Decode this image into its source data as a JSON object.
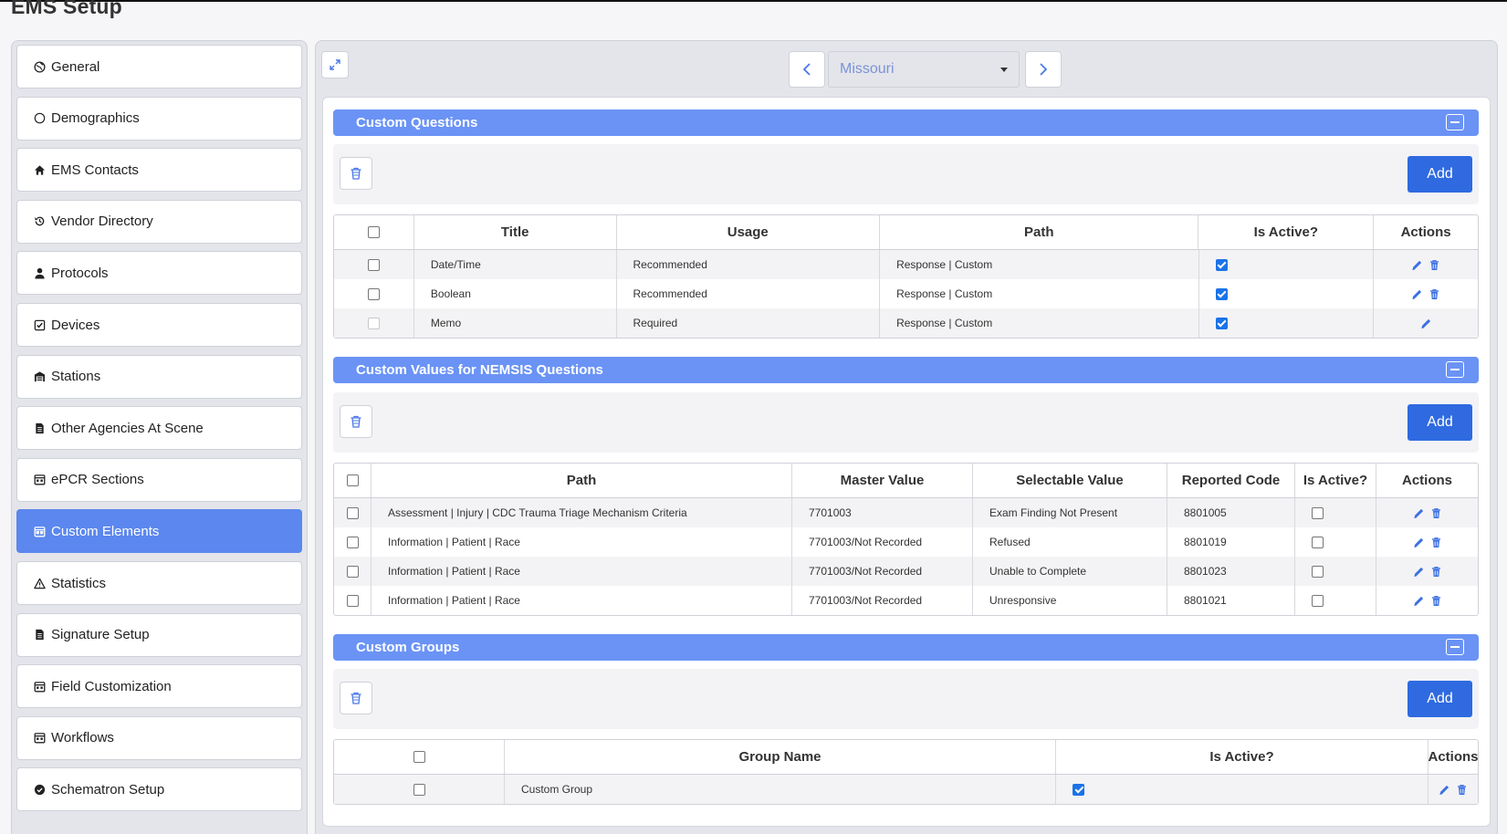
{
  "page": {
    "title": "EMS Setup"
  },
  "sidebar": {
    "items": [
      {
        "label": "General",
        "icon": "globe-icon"
      },
      {
        "label": "Demographics",
        "icon": "circle-icon"
      },
      {
        "label": "EMS Contacts",
        "icon": "home-icon"
      },
      {
        "label": "Vendor Directory",
        "icon": "history-icon"
      },
      {
        "label": "Protocols",
        "icon": "user-icon"
      },
      {
        "label": "Devices",
        "icon": "check-square-icon"
      },
      {
        "label": "Stations",
        "icon": "warehouse-icon"
      },
      {
        "label": "Other Agencies At Scene",
        "icon": "document-icon"
      },
      {
        "label": "ePCR Sections",
        "icon": "calendar-icon"
      },
      {
        "label": "Custom Elements",
        "icon": "calendar-icon",
        "active": true
      },
      {
        "label": "Statistics",
        "icon": "warning-icon"
      },
      {
        "label": "Signature Setup",
        "icon": "document-icon"
      },
      {
        "label": "Field Customization",
        "icon": "calendar-icon"
      },
      {
        "label": "Workflows",
        "icon": "calendar-icon"
      },
      {
        "label": "Schematron Setup",
        "icon": "badge-check-icon"
      }
    ]
  },
  "selector": {
    "value": "Missouri"
  },
  "colors": {
    "accent": "#6a93f5",
    "button": "#2f6ae0",
    "active_nav": "#5b87ee",
    "checked": "#1a73e8"
  },
  "sections": {
    "custom_questions": {
      "title": "Custom Questions",
      "add_label": "Add",
      "columns": [
        "Title",
        "Usage",
        "Path",
        "Is Active?",
        "Actions"
      ],
      "rows": [
        {
          "title": "Date/Time",
          "usage": "Recommended",
          "path": "Response | Custom",
          "active": true,
          "deletable": true
        },
        {
          "title": "Boolean",
          "usage": "Recommended",
          "path": "Response | Custom",
          "active": true,
          "deletable": true
        },
        {
          "title": "Memo",
          "usage": "Required",
          "path": "Response | Custom",
          "active": true,
          "deletable": false
        }
      ]
    },
    "custom_values": {
      "title": "Custom Values for NEMSIS Questions",
      "add_label": "Add",
      "columns": [
        "Path",
        "Master Value",
        "Selectable Value",
        "Reported Code",
        "Is Active?",
        "Actions"
      ],
      "rows": [
        {
          "path": "Assessment | Injury | CDC Trauma Triage Mechanism Criteria",
          "master": "7701003",
          "selectable": "Exam Finding Not Present",
          "code": "8801005",
          "active": false
        },
        {
          "path": "Information | Patient | Race",
          "master": "7701003/Not Recorded",
          "selectable": "Refused",
          "code": "8801019",
          "active": false
        },
        {
          "path": "Information | Patient | Race",
          "master": "7701003/Not Recorded",
          "selectable": "Unable to Complete",
          "code": "8801023",
          "active": false
        },
        {
          "path": "Information | Patient | Race",
          "master": "7701003/Not Recorded",
          "selectable": "Unresponsive",
          "code": "8801021",
          "active": false
        }
      ]
    },
    "custom_groups": {
      "title": "Custom Groups",
      "add_label": "Add",
      "columns": [
        "Group Name",
        "Is Active?",
        "Actions"
      ],
      "rows": [
        {
          "name": "Custom Group",
          "active": true
        }
      ]
    }
  }
}
